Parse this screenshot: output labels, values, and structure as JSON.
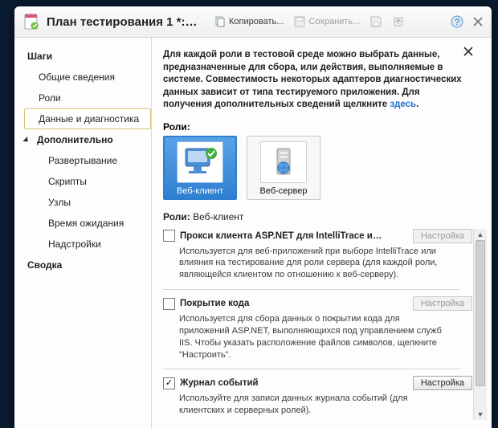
{
  "titlebar": {
    "title": "План тестирования 1 *: т…",
    "copy": "Копировать...",
    "save": "Сохранить..."
  },
  "sidebar": {
    "steps": "Шаги",
    "general": "Общие сведения",
    "roles": "Роли",
    "data_diag": "Данные и диагностика",
    "advanced": "Дополнительно",
    "deployment": "Развертывание",
    "scripts": "Скрипты",
    "hosts": "Узлы",
    "timeouts": "Время ожидания",
    "addins": "Надстройки",
    "summary": "Сводка"
  },
  "intro": {
    "text1": "Для каждой роли в тестовой среде можно выбрать данные, предназначенные для сбора, или действия, выполняемые в системе. Совместимость некоторых адаптеров диагностических данных зависит от типа тестируемого приложения.  Для получения дополнительных сведений щелкните ",
    "link": "здесь",
    "text2": "."
  },
  "roles": {
    "label": "Роли:",
    "items": [
      {
        "label": "Веб-клиент"
      },
      {
        "label": "Веб-сервер"
      }
    ],
    "selected_prefix": "Роли:",
    "selected_name": "Веб-клиент"
  },
  "buttons": {
    "config": "Настройка"
  },
  "diagnostics": [
    {
      "title": "Прокси клиента ASP.NET для IntelliTrace и…",
      "checked": false,
      "config_enabled": false,
      "desc": "Используется для веб-приложений при выборе IntelliTrace или влияния на тестирование для роли сервера (для каждой роли, являющейся клиентом по отношению к веб-серверу)."
    },
    {
      "title": "Покрытие кода",
      "checked": false,
      "config_enabled": false,
      "desc": "Используется для сбора данных о покрытии кода для приложений ASP.NET, выполняющихся под управлением служб IIS.  Чтобы указать расположение файлов символов, щелкните \"Настроить\"."
    },
    {
      "title": "Журнал событий",
      "checked": true,
      "config_enabled": true,
      "desc": "Используйте для записи данных журнала событий (для клиентских и серверных ролей)."
    }
  ]
}
